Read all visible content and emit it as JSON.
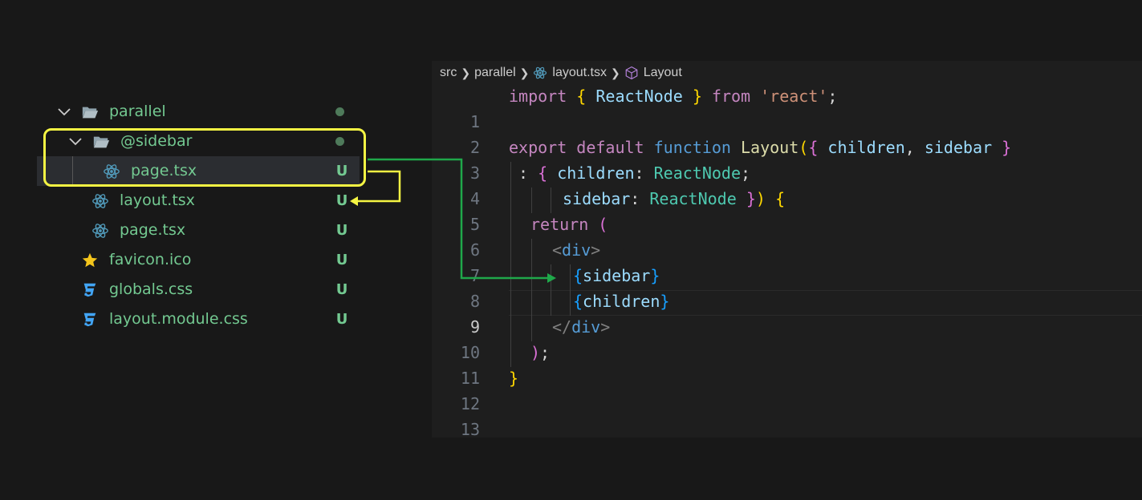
{
  "explorer": {
    "items": [
      {
        "label": "parallel",
        "icon": "folder-open-icon",
        "status": "dot",
        "expanded": true
      },
      {
        "label": "@sidebar",
        "icon": "folder-open-icon",
        "status": "dot",
        "expanded": true
      },
      {
        "label": "page.tsx",
        "icon": "react-icon",
        "status": "U"
      },
      {
        "label": "layout.tsx",
        "icon": "react-icon",
        "status": "U"
      },
      {
        "label": "page.tsx",
        "icon": "react-icon",
        "status": "U"
      },
      {
        "label": "favicon.ico",
        "icon": "star-icon",
        "status": "U"
      },
      {
        "label": "globals.css",
        "icon": "css-icon",
        "status": "U"
      },
      {
        "label": "layout.module.css",
        "icon": "css-icon",
        "status": "U"
      }
    ]
  },
  "breadcrumb": {
    "parts": [
      "src",
      "parallel",
      "layout.tsx",
      "Layout"
    ],
    "icons": [
      "",
      "",
      "react-icon",
      "symbol-method-icon"
    ]
  },
  "editor": {
    "current_line": 9,
    "line_numbers": [
      "1",
      "2",
      "3",
      "4",
      "5",
      "6",
      "7",
      "8",
      "9",
      "10",
      "11",
      "12",
      "13"
    ],
    "tokens": {
      "l1": [
        "import",
        " ",
        "{",
        " ",
        "ReactNode",
        " ",
        "}",
        " ",
        "from",
        " ",
        "'react'",
        ";"
      ],
      "l3": [
        "export",
        " ",
        "default",
        " ",
        "function",
        " ",
        "Layout",
        "(",
        "{",
        " ",
        "children",
        ",",
        " ",
        "sidebar",
        " ",
        "}"
      ],
      "l4": [
        ":",
        " ",
        "{",
        " ",
        "children",
        ":",
        " ",
        "ReactNode",
        ";"
      ],
      "l5": [
        "sidebar",
        ":",
        " ",
        "ReactNode",
        " ",
        "}",
        ")",
        " ",
        "{"
      ],
      "l6": [
        "return",
        " ",
        "("
      ],
      "l7": [
        "<",
        "div",
        ">"
      ],
      "l8": [
        "{",
        "sidebar",
        "}"
      ],
      "l9": [
        "{",
        "children",
        "}"
      ],
      "l10": [
        "</",
        "div",
        ">"
      ],
      "l11": [
        ")",
        ";"
      ],
      "l12": [
        "}"
      ]
    }
  },
  "colors": {
    "highlight_box": "#f5f543",
    "arrow_green": "#1fa84a",
    "untracked_status": "#73c991",
    "react_icon": "#519aba"
  }
}
